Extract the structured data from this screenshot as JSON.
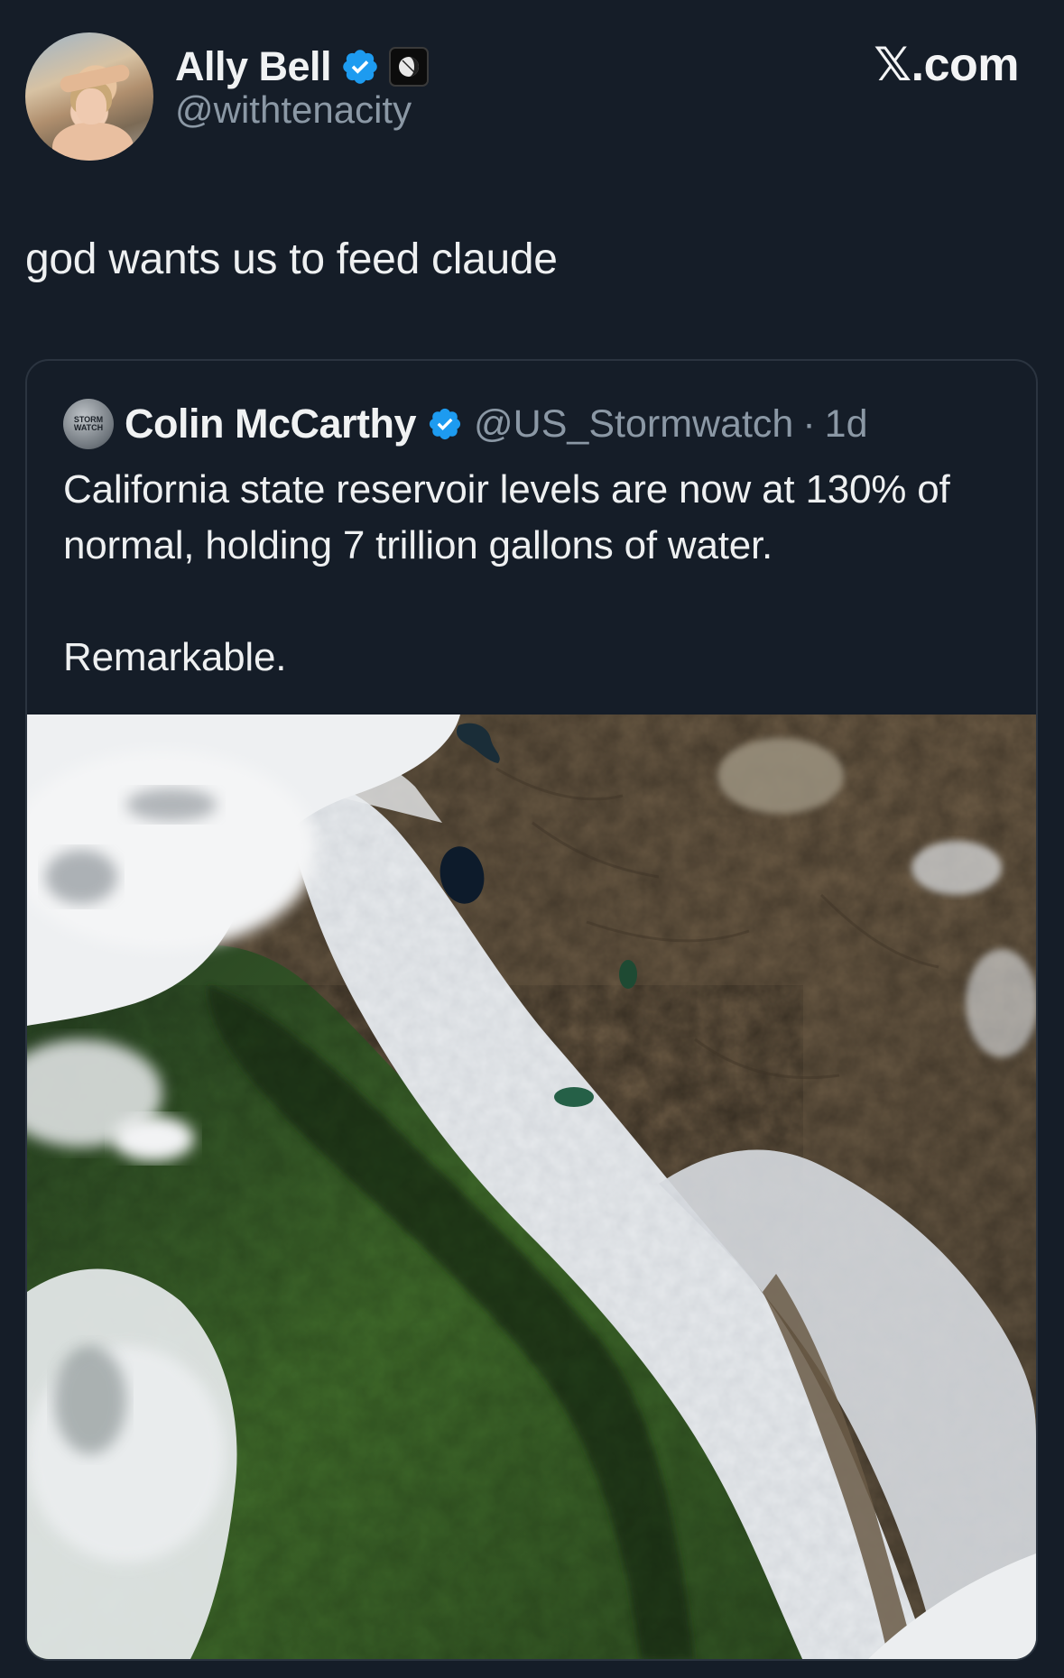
{
  "author": {
    "display_name": "Ally Bell",
    "handle": "@withtenacity",
    "verified": true,
    "avatar_icon": "profile-photo",
    "affiliate_icon": "affiliate-badge-icon"
  },
  "brand": {
    "label": "𝕏.com"
  },
  "post": {
    "text": "god wants us to feed claude"
  },
  "quote": {
    "avatar_text": "STORM WATCH",
    "display_name": "Colin McCarthy",
    "verified": true,
    "handle": "@US_Stormwatch",
    "separator": "·",
    "time": "1d",
    "text_line_1": "California state reservoir levels are now at 130% of normal, holding 7 trillion gallons of water.",
    "text_line_2": "Remarkable.",
    "media_icon": "satellite-image"
  },
  "colors": {
    "background": "#151d28",
    "verified_blue": "#1d9bf0",
    "muted_text": "#8b98a5",
    "card_border": "#2b3440"
  }
}
